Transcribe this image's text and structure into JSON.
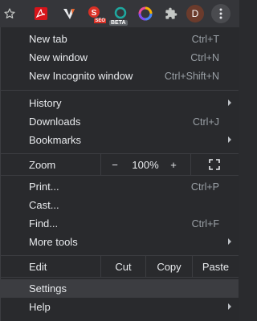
{
  "toolbar": {
    "icons": [
      "star-icon",
      "acrobat-icon",
      "v-extension-icon",
      "seo-extension-icon",
      "beta-extension-icon",
      "color-picker-icon",
      "extensions-puzzle-icon",
      "profile-avatar",
      "more-menu-icon"
    ],
    "beta_badge": "BETA",
    "seo_badge": "SEO",
    "avatar_letter": "D"
  },
  "menu": {
    "new_tab": {
      "label": "New tab",
      "shortcut": "Ctrl+T"
    },
    "new_window": {
      "label": "New window",
      "shortcut": "Ctrl+N"
    },
    "new_incognito": {
      "label": "New Incognito window",
      "shortcut": "Ctrl+Shift+N"
    },
    "history": {
      "label": "History"
    },
    "downloads": {
      "label": "Downloads",
      "shortcut": "Ctrl+J"
    },
    "bookmarks": {
      "label": "Bookmarks"
    },
    "zoom": {
      "label": "Zoom",
      "minus": "−",
      "level": "100%",
      "plus": "+"
    },
    "print": {
      "label": "Print...",
      "shortcut": "Ctrl+P"
    },
    "cast": {
      "label": "Cast..."
    },
    "find": {
      "label": "Find...",
      "shortcut": "Ctrl+F"
    },
    "more_tools": {
      "label": "More tools"
    },
    "edit": {
      "label": "Edit",
      "cut": "Cut",
      "copy": "Copy",
      "paste": "Paste"
    },
    "settings": {
      "label": "Settings"
    },
    "help": {
      "label": "Help"
    }
  },
  "colors": {
    "menu_bg": "#292a2d",
    "toolbar_bg": "#35363a",
    "highlight": "#3c3d41",
    "text": "#e8eaed",
    "shortcut_text": "#9aa0a6"
  }
}
